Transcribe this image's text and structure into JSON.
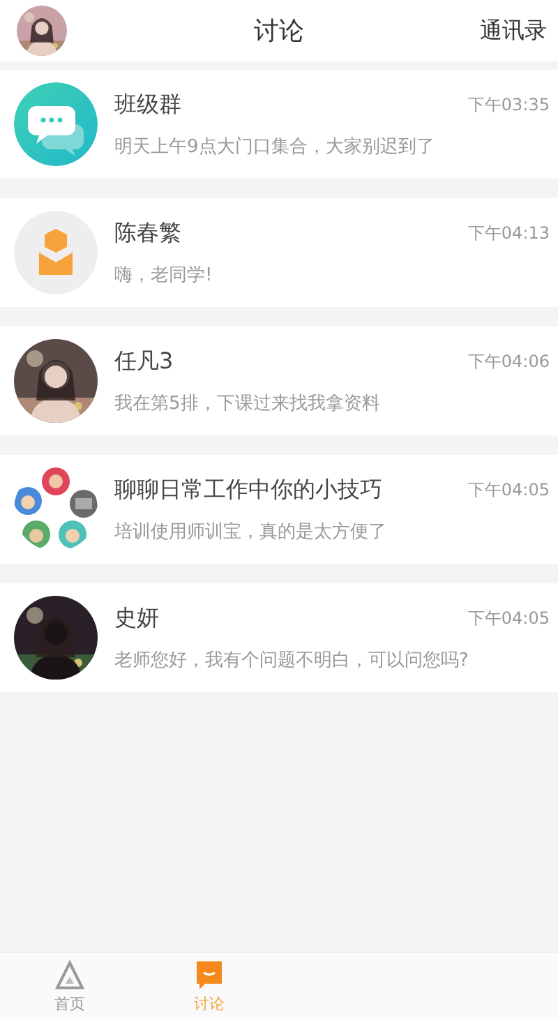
{
  "header": {
    "title": "讨论",
    "contacts_link": "通讯录"
  },
  "conversations": [
    {
      "kind": "chat-bubble",
      "name": "班级群",
      "time": "下午03:35",
      "message": "明天上午9点大门口集合，大家别迟到了"
    },
    {
      "kind": "default-user",
      "name": "陈春繁",
      "time": "下午04:13",
      "message": "嗨，老同学!"
    },
    {
      "kind": "picture",
      "name": "任凡3",
      "time": "下午04:06",
      "message": "我在第5排，下课过来找我拿资料"
    },
    {
      "kind": "group-collage",
      "name": "聊聊日常工作中你的小技巧",
      "time": "下午04:05",
      "message": "培训使用师训宝，真的是太方便了"
    },
    {
      "kind": "picture",
      "name": "史妍",
      "time": "下午04:05",
      "message": "老师您好，我有个问题不明白，可以问您吗?"
    }
  ],
  "tab_bar": [
    {
      "kind": "home",
      "label": "首页",
      "selected": false
    },
    {
      "kind": "discuss",
      "label": "讨论",
      "selected": true
    }
  ]
}
